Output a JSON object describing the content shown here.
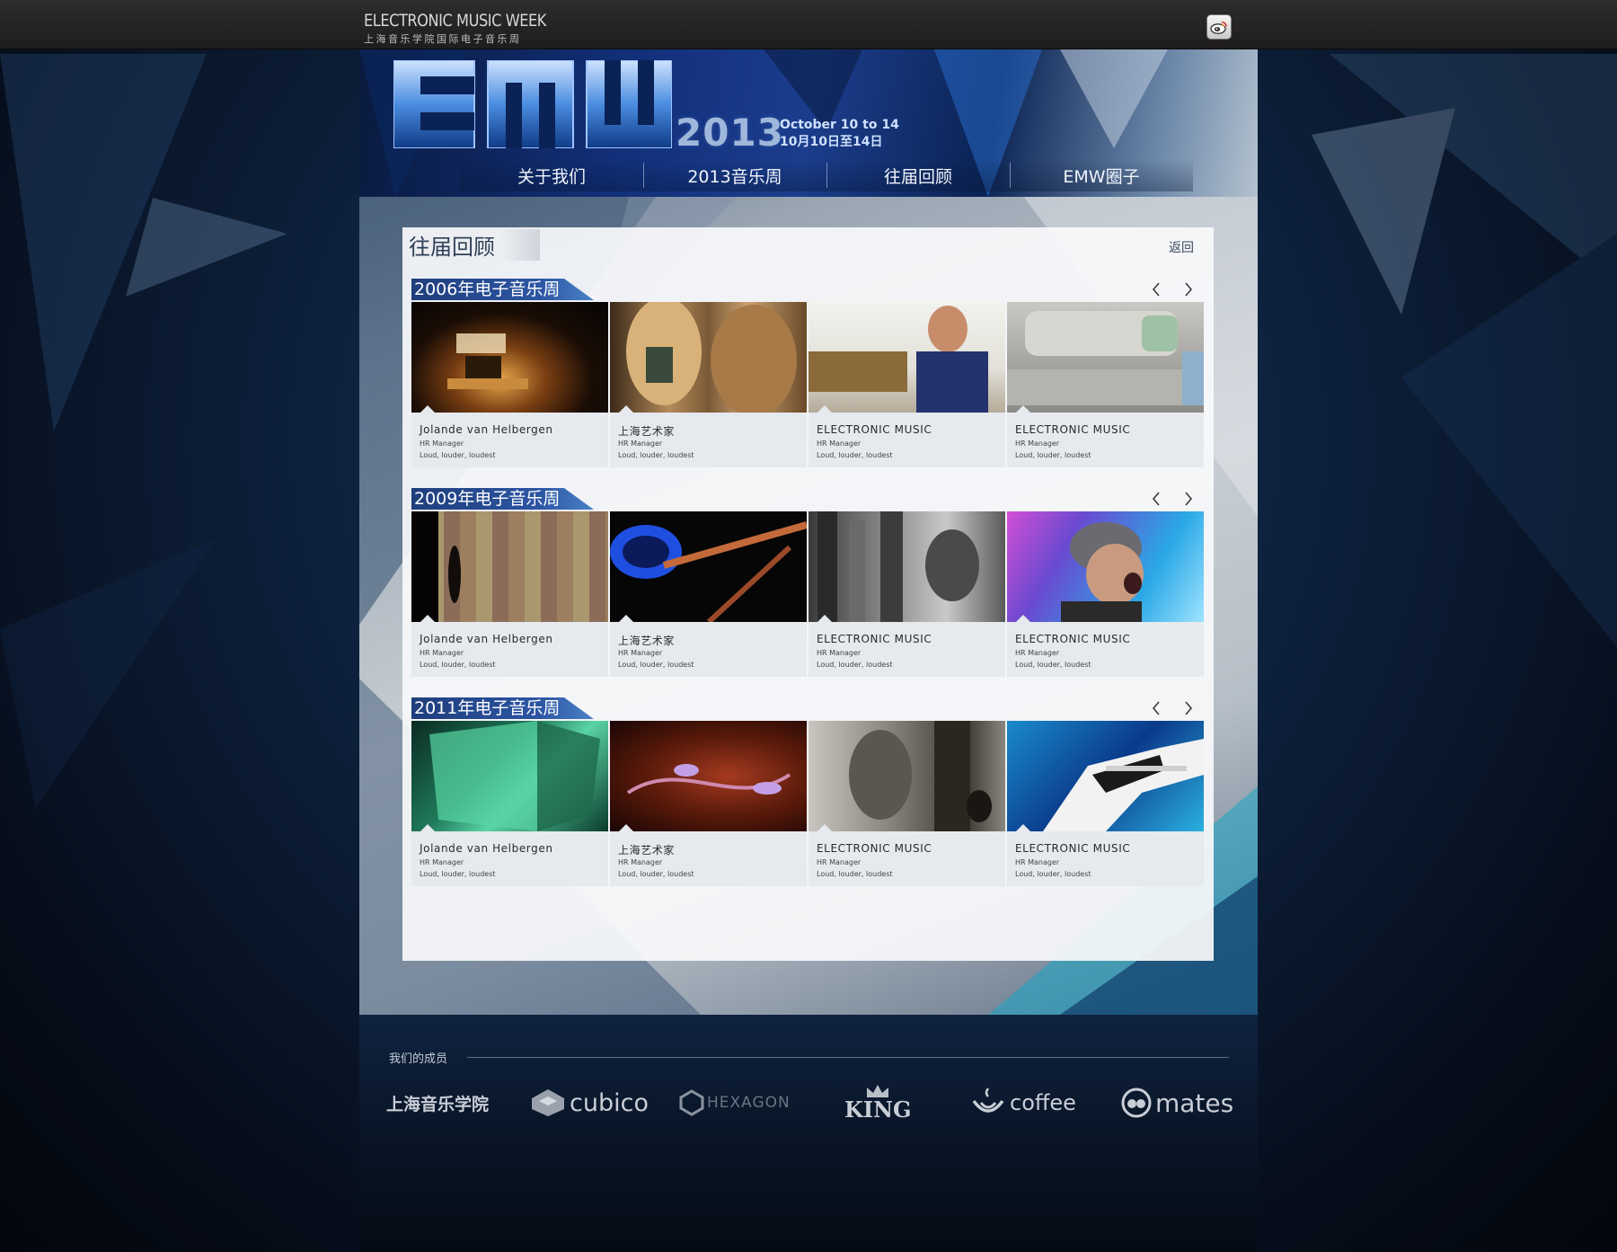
{
  "site": {
    "brand_en": "ELECTRONIC MUSIC WEEK",
    "brand_cn": "上海音乐学院国际电子音乐周"
  },
  "top_bar": {
    "share_icon": "weibo-icon"
  },
  "banner": {
    "logo": "EMW",
    "year": "2013",
    "date_en": "October 10 to 14",
    "date_cn": "10月10日至14日"
  },
  "nav": [
    {
      "label": "关于我们"
    },
    {
      "label": "2013音乐周"
    },
    {
      "label": "往届回顾"
    },
    {
      "label": "EMW圈子"
    }
  ],
  "panel": {
    "title": "往届回顾",
    "back_label": "返回"
  },
  "sections": [
    {
      "title": "2006年电子音乐周",
      "items": [
        {
          "name": "Jolande van Helbergen",
          "role": "HR Manager",
          "desc": "Loud, louder, loudest"
        },
        {
          "name": "上海艺术家",
          "role": "HR Manager",
          "desc": "Loud, louder, loudest"
        },
        {
          "name": "ELECTRONIC MUSIC",
          "role": "HR Manager",
          "desc": "Loud, louder, loudest"
        },
        {
          "name": "ELECTRONIC MUSIC",
          "role": "HR Manager",
          "desc": "Loud, louder, loudest"
        }
      ]
    },
    {
      "title": "2009年电子音乐周",
      "items": [
        {
          "name": "Jolande van Helbergen",
          "role": "HR Manager",
          "desc": "Loud, louder, loudest"
        },
        {
          "name": "上海艺术家",
          "role": "HR Manager",
          "desc": "Loud, louder, loudest"
        },
        {
          "name": "ELECTRONIC MUSIC",
          "role": "HR Manager",
          "desc": "Loud, louder, loudest"
        },
        {
          "name": "ELECTRONIC MUSIC",
          "role": "HR Manager",
          "desc": "Loud, louder, loudest"
        }
      ]
    },
    {
      "title": "2011年电子音乐周",
      "items": [
        {
          "name": "Jolande van Helbergen",
          "role": "HR Manager",
          "desc": "Loud, louder, loudest"
        },
        {
          "name": "上海艺术家",
          "role": "HR Manager",
          "desc": "Loud, louder, loudest"
        },
        {
          "name": "ELECTRONIC MUSIC",
          "role": "HR Manager",
          "desc": "Loud, louder, loudest"
        },
        {
          "name": "ELECTRONIC MUSIC",
          "role": "HR Manager",
          "desc": "Loud, louder, loudest"
        }
      ]
    }
  ],
  "footer": {
    "members_label": "我们的成员",
    "partners": [
      {
        "name": "上海音乐学院"
      },
      {
        "name": "cubico"
      },
      {
        "name": "HEXAGON"
      },
      {
        "name": "KING"
      },
      {
        "name": "coffee"
      },
      {
        "name": "mates"
      }
    ]
  },
  "colors": {
    "topbar": "#2a2827",
    "nav_text": "#f0f4fa",
    "section_label": "#2c55a3",
    "panel_bg": "#f8f9fb",
    "card_bg": "#e6e9ee",
    "footer_bg": "#0a182c"
  }
}
